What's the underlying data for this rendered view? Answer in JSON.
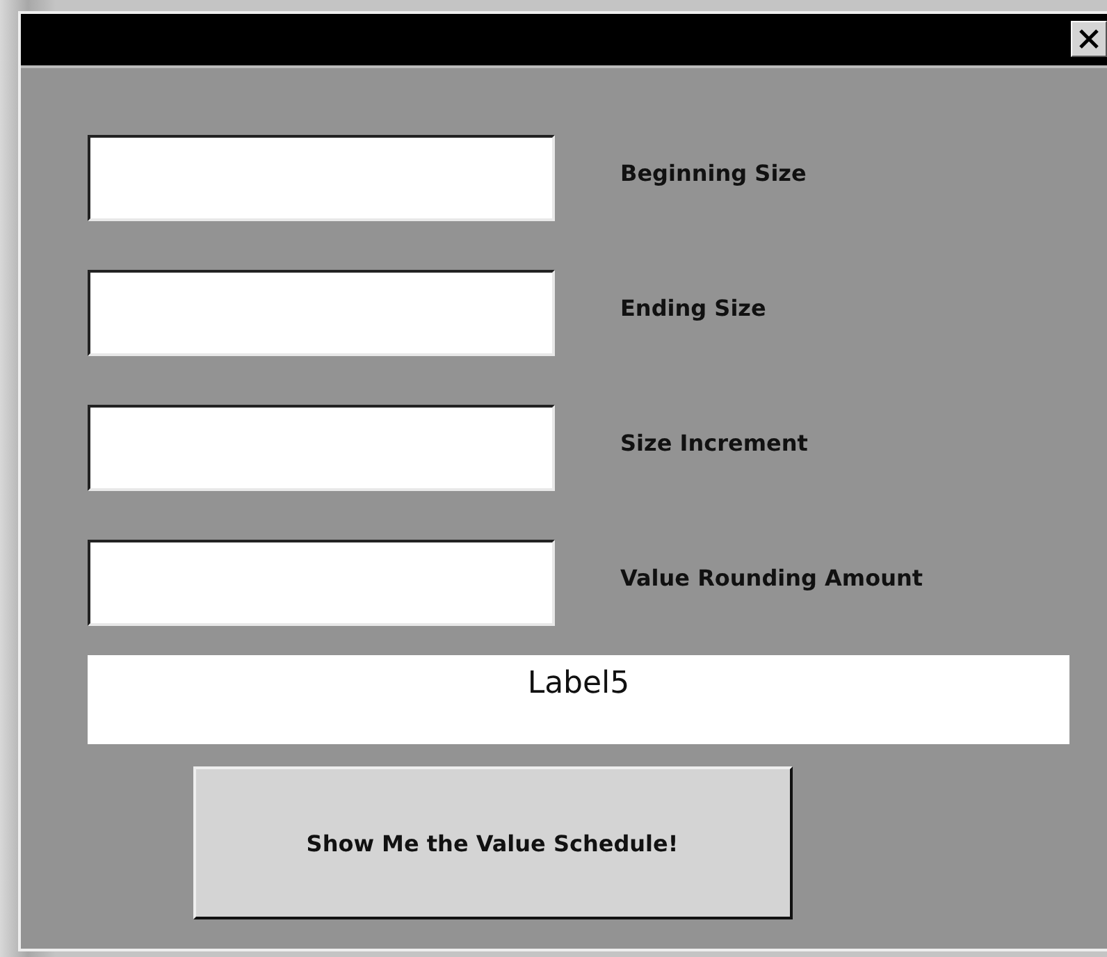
{
  "dialog": {
    "fields": [
      {
        "label": "Beginning Size"
      },
      {
        "label": "Ending Size"
      },
      {
        "label": "Size Increment"
      },
      {
        "label": "Value Rounding Amount"
      }
    ],
    "output_label": "Label5",
    "button": "Show Me the Value Schedule!"
  }
}
